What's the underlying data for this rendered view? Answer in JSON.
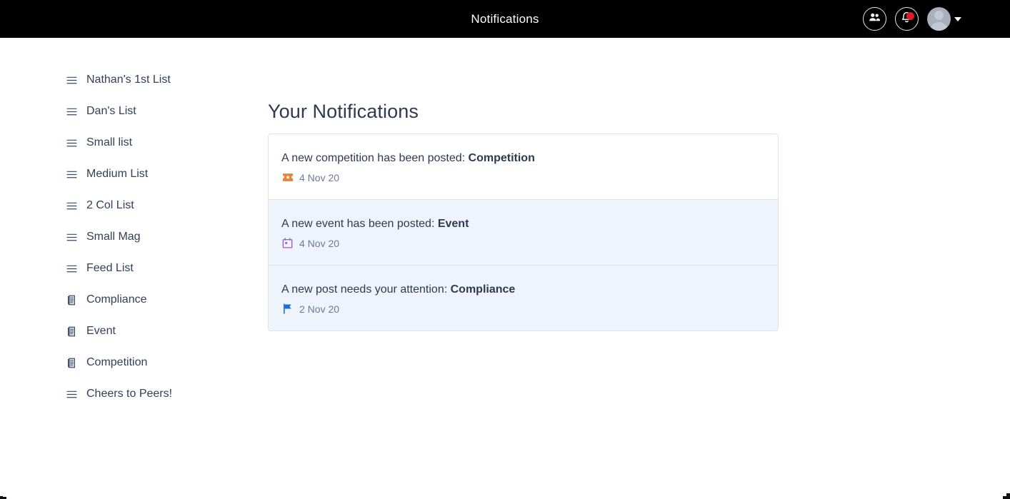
{
  "topbar": {
    "title": "Notifications",
    "people_icon": "people-icon",
    "bell_icon": "bell-icon",
    "bell_badge": true,
    "avatar_icon": "avatar",
    "caret_icon": "chevron-down-icon",
    "background": "#000000",
    "title_color": "#ffffff",
    "badge_color": "#e01b24"
  },
  "sidebar": {
    "items": [
      {
        "label": "Nathan's 1st List",
        "icon": "list-icon"
      },
      {
        "label": "Dan's List",
        "icon": "list-icon"
      },
      {
        "label": "Small list",
        "icon": "list-icon"
      },
      {
        "label": "Medium List",
        "icon": "list-icon"
      },
      {
        "label": "2 Col List",
        "icon": "list-icon"
      },
      {
        "label": "Small Mag",
        "icon": "list-icon"
      },
      {
        "label": "Feed List",
        "icon": "list-icon"
      },
      {
        "label": "Compliance",
        "icon": "document-icon"
      },
      {
        "label": "Event",
        "icon": "document-icon"
      },
      {
        "label": "Competition",
        "icon": "document-icon"
      },
      {
        "label": "Cheers to Peers!",
        "icon": "list-icon"
      }
    ]
  },
  "main": {
    "title": "Your Notifications",
    "notifications": [
      {
        "text": "A new competition has been posted: ",
        "subject": "Competition",
        "date": "4 Nov 20",
        "icon": "ticket-icon",
        "icon_color": "#e8833a",
        "unread": false
      },
      {
        "text": "A new event has been posted: ",
        "subject": "Event",
        "date": "4 Nov 20",
        "icon": "calendar-icon",
        "icon_color": "#9b59c4",
        "unread": true
      },
      {
        "text": "A new post needs your attention: ",
        "subject": "Compliance",
        "date": "2 Nov 20",
        "icon": "flag-icon",
        "icon_color": "#1a6fe0",
        "unread": true
      }
    ]
  }
}
